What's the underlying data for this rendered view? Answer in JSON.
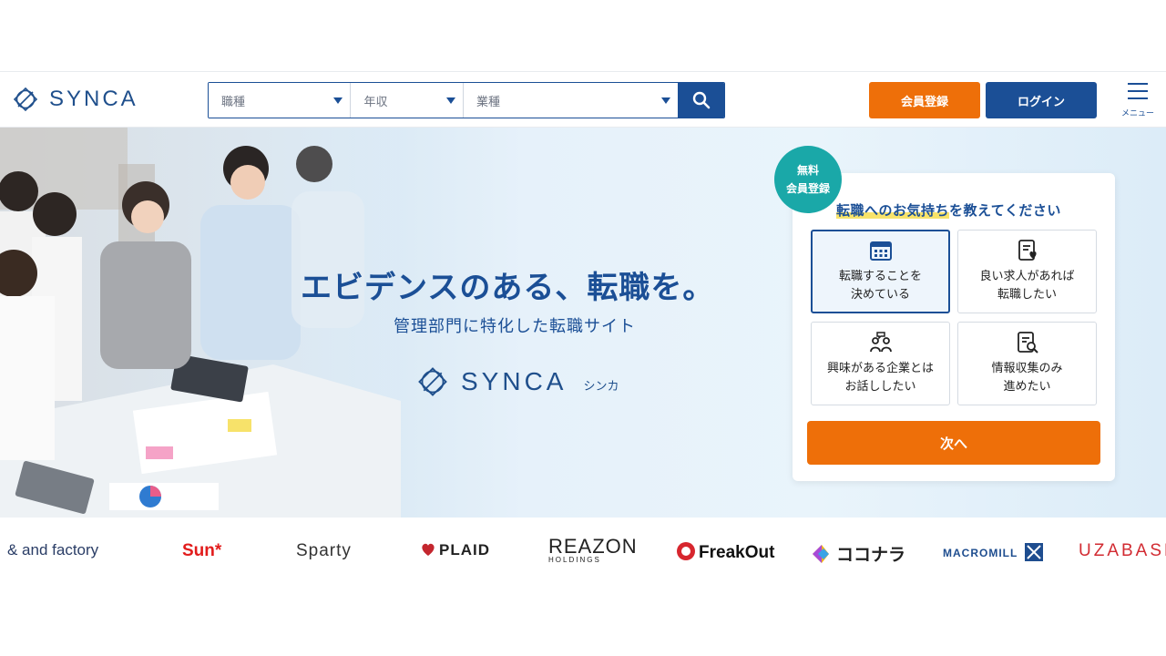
{
  "header": {
    "logo_text": "SYNCA",
    "search": {
      "job_type": "職種",
      "salary": "年収",
      "industry": "業種"
    },
    "register_label": "会員登録",
    "login_label": "ログイン",
    "menu_label": "メニュー"
  },
  "hero": {
    "title": "エビデンスのある、転職を。",
    "subtitle": "管理部門に特化した転職サイト",
    "logo_text": "SYNCA",
    "logo_kana": "シンカ"
  },
  "card": {
    "badge_line1": "無料",
    "badge_line2": "会員登録",
    "title_highlight": "転職へのお気持ち",
    "title_rest": "を教えてください",
    "options": [
      {
        "line1": "転職することを",
        "line2": "決めている",
        "icon": "calendar-icon"
      },
      {
        "line1": "良い求人があれば",
        "line2": "転職したい",
        "icon": "document-heart-icon"
      },
      {
        "line1": "興味がある企業とは",
        "line2": "お話ししたい",
        "icon": "people-talk-icon"
      },
      {
        "line1": "情報収集のみ",
        "line2": "進めたい",
        "icon": "document-search-icon"
      }
    ],
    "next_label": "次へ"
  },
  "logos": {
    "and_factory": "& and factory",
    "sun": "Sun*",
    "sparty": "Sparty",
    "plaid": "PLAID",
    "reazon": "REAZON",
    "reazon_sub": "HOLDINGS",
    "freakout": "FreakOut",
    "coconala": "ココナラ",
    "macromill": "MACROMILL",
    "uzabase": "UZABASE"
  },
  "colors": {
    "brand_blue": "#1b4f96",
    "orange": "#ee6f09",
    "teal": "#1aa8a8",
    "highlight_yellow": "#f8e36a"
  }
}
